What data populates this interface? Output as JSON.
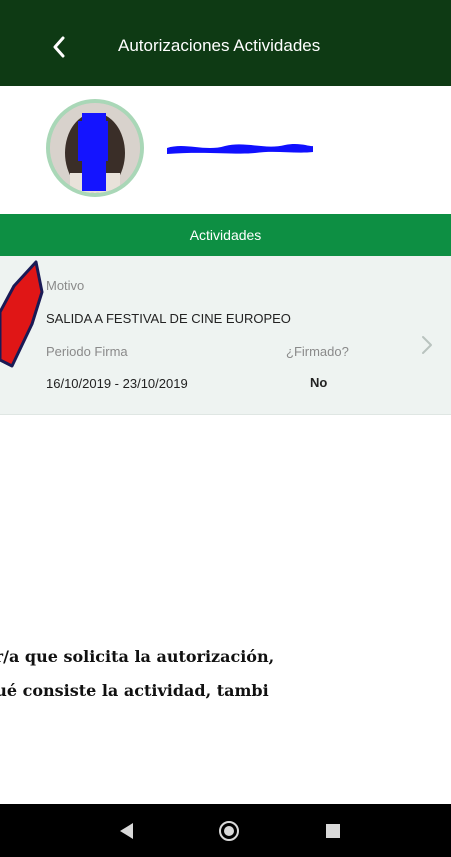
{
  "header": {
    "title": "Autorizaciones Actividades",
    "back_icon": "chevron-left-icon"
  },
  "profile": {
    "avatar": "avatar",
    "name_redacted": true
  },
  "tab": {
    "label": "Actividades"
  },
  "activity": {
    "motivo_label": "Motivo",
    "motivo_value": "SALIDA A FESTIVAL DE CINE EUROPEO",
    "periodo_label": "Periodo Firma",
    "periodo_value": "16/10/2019 - 23/10/2019",
    "firmado_label": "¿Firmado?",
    "firmado_value": "No"
  },
  "caption": {
    "line1": "or/a que solicita la autorización,",
    "line2": "qué consiste la actividad, tambi"
  },
  "colors": {
    "header_bg": "#0e3a14",
    "tab_bg": "#0d8f43",
    "card_bg": "#eef3f1",
    "annotation_red": "#e01616",
    "redaction_blue": "#1010ff"
  }
}
